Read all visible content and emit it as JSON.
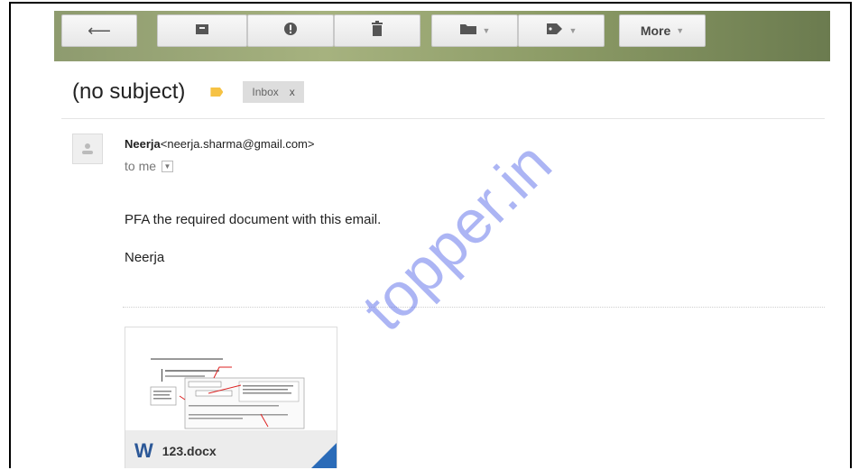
{
  "toolbar": {
    "buttons": [
      {
        "name": "back-button",
        "icon": "arrow-left-icon",
        "glyph": "⟵"
      },
      {
        "name": "archive-button",
        "icon": "archive-icon",
        "glyph": "▣"
      },
      {
        "name": "report-spam-button",
        "icon": "alert-icon",
        "glyph": "❗"
      },
      {
        "name": "delete-button",
        "icon": "trash-icon",
        "glyph": "🗑"
      },
      {
        "name": "move-to-button",
        "icon": "folder-icon",
        "glyph": "▬"
      },
      {
        "name": "labels-button",
        "icon": "tag-icon",
        "glyph": "⬟"
      }
    ],
    "more_label": "More"
  },
  "message": {
    "subject": "(no subject)",
    "label_color": "#f6c244",
    "inbox_label": "Inbox",
    "remove_label": "x",
    "sender_name": "Neerja",
    "sender_email": "<neerja.sharma@gmail.com>",
    "to_text": "to me",
    "body": [
      "PFA the required document with this email.",
      "Neerja"
    ]
  },
  "attachment": {
    "filename": "123.docx",
    "icon_letter": "W",
    "icon_color": "#2b5797"
  },
  "watermark": {
    "text": "topper.in"
  }
}
